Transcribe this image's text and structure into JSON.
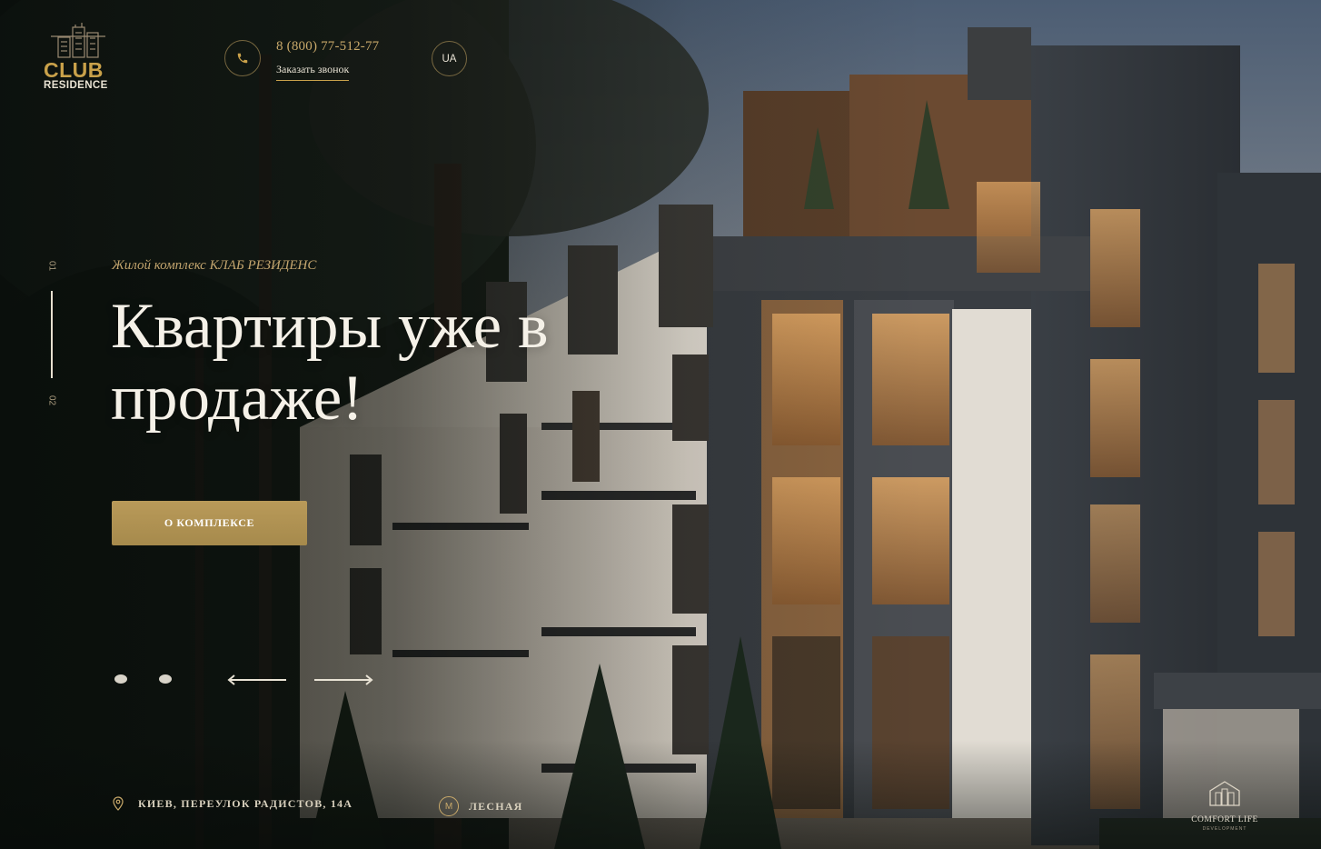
{
  "logo": {
    "word": "CLUB",
    "sub": "RESIDENCE"
  },
  "header": {
    "phone": "8 (800) 77-512-77",
    "callback_label": "Заказать звонок",
    "lang": "UA"
  },
  "slider": {
    "current": "01",
    "next": "02"
  },
  "hero": {
    "subtitle": "Жилой комплекс КЛАБ РЕЗИДЕНС",
    "headline": "Квартиры уже в продаже!",
    "cta_label": "О КОМПЛЕКСЕ"
  },
  "footer": {
    "address": "КИЕВ, ПЕРЕУЛОК РАДИСТОВ, 14А",
    "metro_letter": "M",
    "metro_station": "ЛЕСНАЯ"
  },
  "developer": {
    "name": "COMFORT LIFE",
    "tagline": "DEVELOPMENT"
  },
  "colors": {
    "accent": "#c9a14a",
    "button": "#b39553",
    "text_light": "#f5f1e8"
  },
  "icons": [
    "phone-icon",
    "location-pin-icon",
    "metro-icon",
    "arrow-left-icon",
    "arrow-right-icon",
    "building-logo-icon"
  ]
}
